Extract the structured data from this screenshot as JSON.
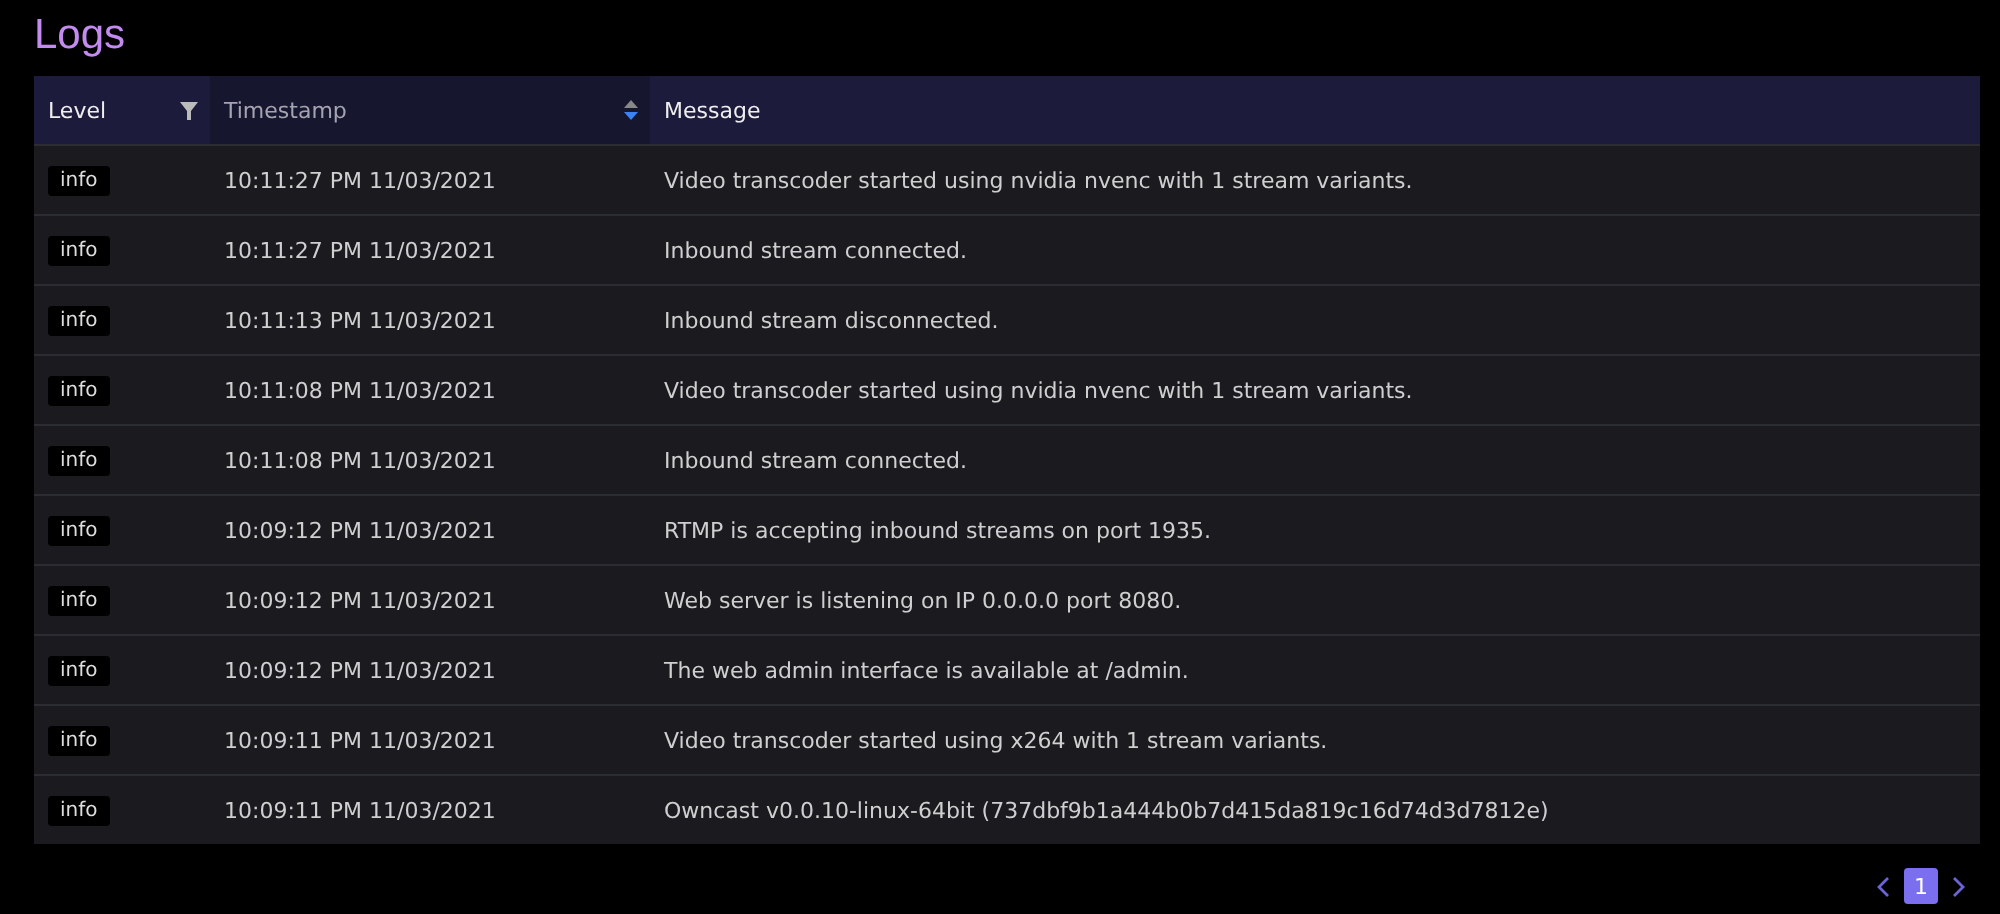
{
  "title": "Logs",
  "table": {
    "columns": [
      {
        "label": "Level",
        "kind": "filter"
      },
      {
        "label": "Timestamp",
        "kind": "sort",
        "sorted_descending": true
      },
      {
        "label": "Message",
        "kind": "plain"
      }
    ],
    "rows": [
      {
        "level": "info",
        "timestamp": "10:11:27 PM 11/03/2021",
        "message": "Video transcoder started using nvidia nvenc with 1 stream variants."
      },
      {
        "level": "info",
        "timestamp": "10:11:27 PM 11/03/2021",
        "message": "Inbound stream connected."
      },
      {
        "level": "info",
        "timestamp": "10:11:13 PM 11/03/2021",
        "message": "Inbound stream disconnected."
      },
      {
        "level": "info",
        "timestamp": "10:11:08 PM 11/03/2021",
        "message": "Video transcoder started using nvidia nvenc with 1 stream variants."
      },
      {
        "level": "info",
        "timestamp": "10:11:08 PM 11/03/2021",
        "message": "Inbound stream connected."
      },
      {
        "level": "info",
        "timestamp": "10:09:12 PM 11/03/2021",
        "message": "RTMP is accepting inbound streams on port 1935."
      },
      {
        "level": "info",
        "timestamp": "10:09:12 PM 11/03/2021",
        "message": "Web server is listening on IP 0.0.0.0 port 8080."
      },
      {
        "level": "info",
        "timestamp": "10:09:12 PM 11/03/2021",
        "message": "The web admin interface is available at /admin."
      },
      {
        "level": "info",
        "timestamp": "10:09:11 PM 11/03/2021",
        "message": "Video transcoder started using x264 with 1 stream variants."
      },
      {
        "level": "info",
        "timestamp": "10:09:11 PM 11/03/2021",
        "message": "Owncast v0.0.10-linux-64bit (737dbf9b1a444b0b7d415da819c16d74d3d7812e)"
      }
    ]
  },
  "pagination": {
    "pages": [
      {
        "label": "1",
        "selected": true
      }
    ]
  }
}
